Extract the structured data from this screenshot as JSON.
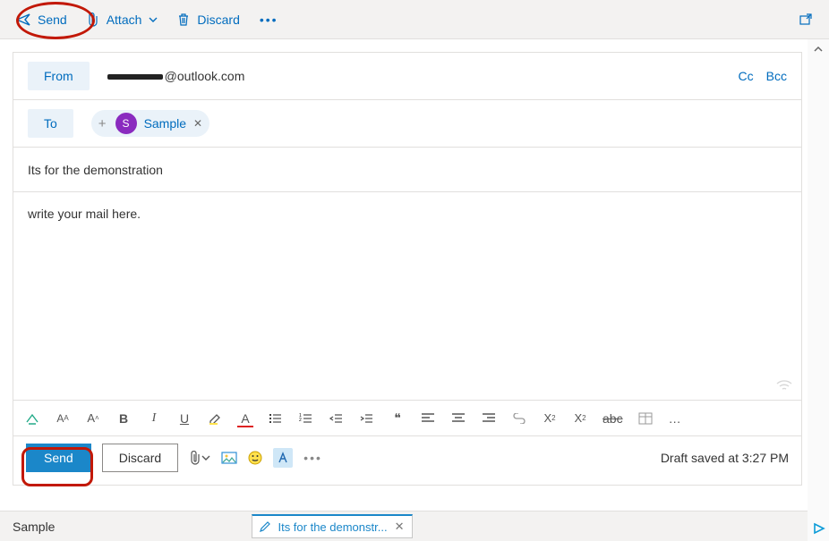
{
  "commandbar": {
    "send": "Send",
    "attach": "Attach",
    "discard": "Discard"
  },
  "from": {
    "button": "From",
    "domain": "@outlook.com",
    "cc": "Cc",
    "bcc": "Bcc"
  },
  "to": {
    "button": "To",
    "recipients": [
      {
        "initial": "S",
        "name": "Sample"
      }
    ]
  },
  "subject": "Its for the demonstration",
  "body": "write your mail here.",
  "actions": {
    "send": "Send",
    "discard": "Discard",
    "draft_status": "Draft saved at 3:27 PM"
  },
  "bottom": {
    "name": "Sample",
    "draft_title": "Its for the demonstr..."
  },
  "format": {
    "bold": "B",
    "italic": "I",
    "underline": "U",
    "fontcolor": "A",
    "quote": "❝",
    "strike": "abc",
    "more": "…"
  }
}
